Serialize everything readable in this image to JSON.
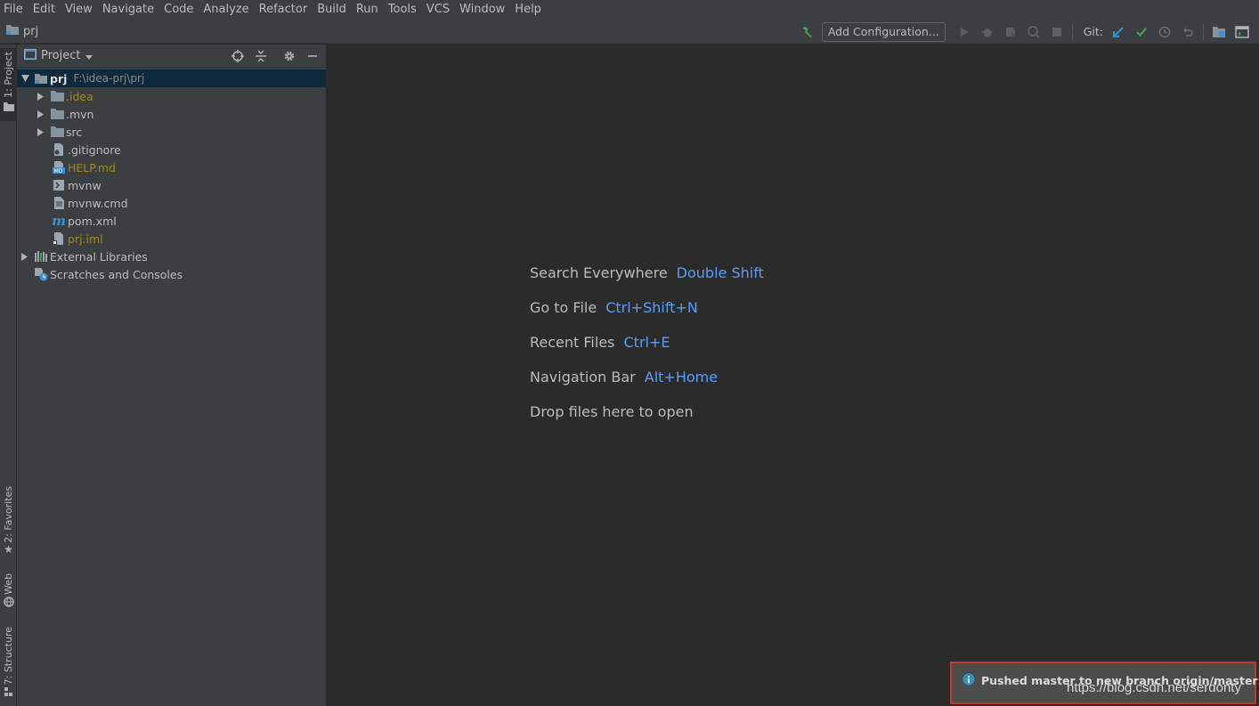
{
  "menu": [
    "File",
    "Edit",
    "View",
    "Navigate",
    "Code",
    "Analyze",
    "Refactor",
    "Build",
    "Run",
    "Tools",
    "VCS",
    "Window",
    "Help"
  ],
  "navbar": {
    "project_name": "prj",
    "add_configuration": "Add Configuration...",
    "git_label": "Git:"
  },
  "stripe": {
    "project": "1: Project",
    "favorites": "2: Favorites",
    "web": "Web",
    "structure": "7: Structure"
  },
  "panel": {
    "title": "Project"
  },
  "tree": {
    "root": {
      "label": "prj",
      "path": "F:\\idea-prj\\prj"
    },
    "items": [
      {
        "label": ".idea"
      },
      {
        "label": ".mvn"
      },
      {
        "label": "src"
      },
      {
        "label": ".gitignore"
      },
      {
        "label": "HELP.md"
      },
      {
        "label": "mvnw"
      },
      {
        "label": "mvnw.cmd"
      },
      {
        "label": "pom.xml"
      },
      {
        "label": "prj.iml"
      }
    ],
    "external_libraries": "External Libraries",
    "scratches": "Scratches and Consoles"
  },
  "hints": [
    {
      "text": "Search Everywhere",
      "key": "Double Shift"
    },
    {
      "text": "Go to File",
      "key": "Ctrl+Shift+N"
    },
    {
      "text": "Recent Files",
      "key": "Ctrl+E"
    },
    {
      "text": "Navigation Bar",
      "key": "Alt+Home"
    },
    {
      "text": "Drop files here to open",
      "key": ""
    }
  ],
  "notification": {
    "text": "Pushed master to new branch origin/master"
  },
  "watermark": "https://blog.csdn.net/serdonty",
  "colors": {
    "accent": "#589df6",
    "selection": "#0d293e",
    "modified_file": "#9e8a1c",
    "build_icon": "#499c54",
    "highlight_border": "#c0392b"
  }
}
